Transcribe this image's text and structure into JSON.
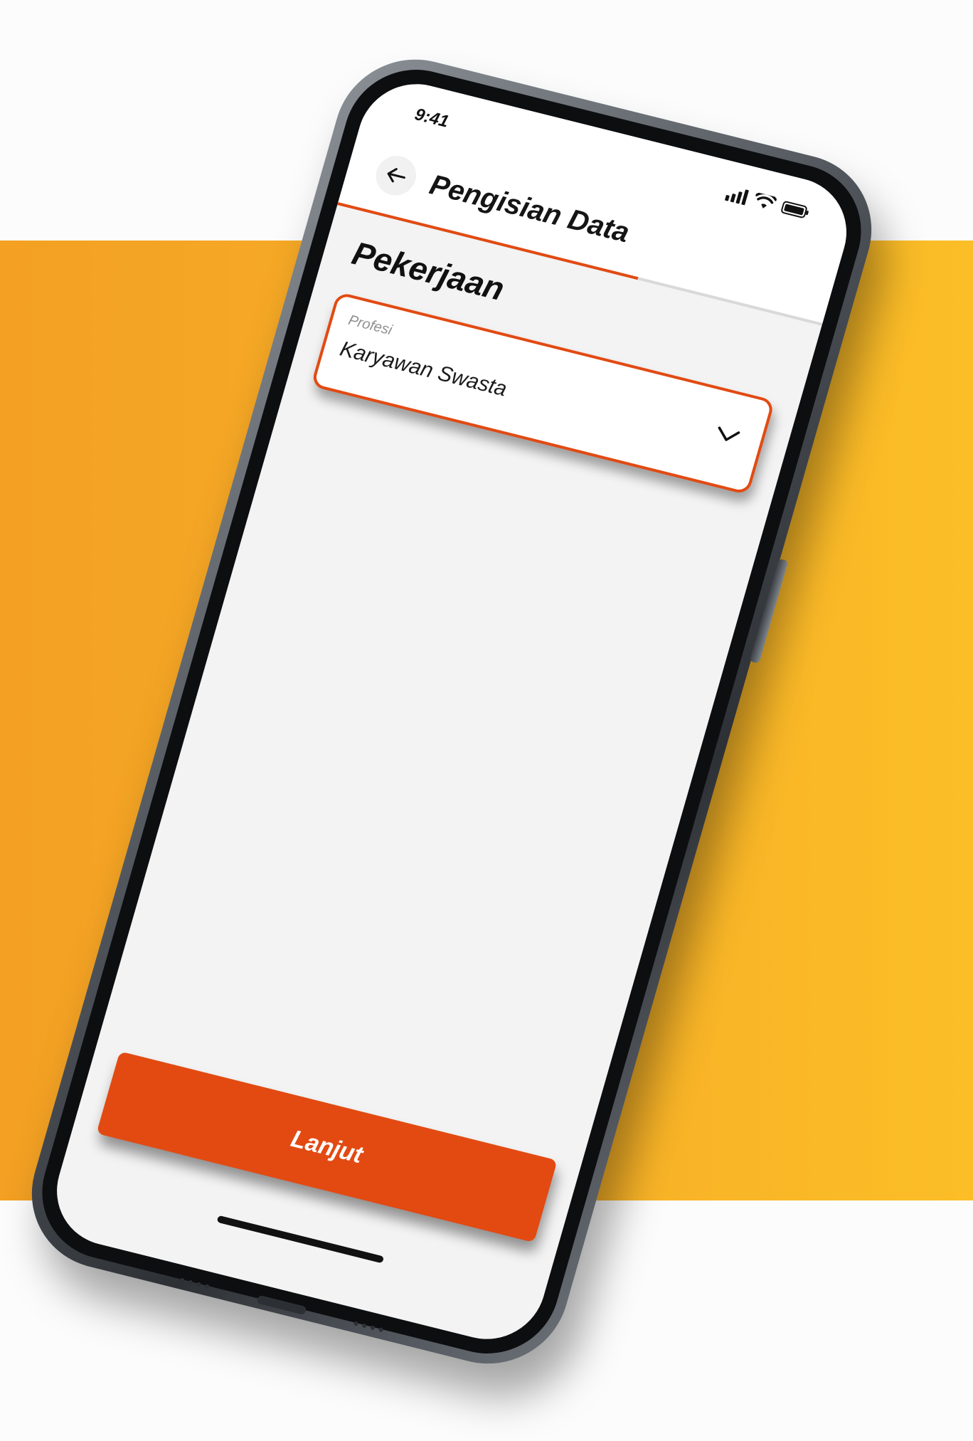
{
  "status_bar": {
    "time": "9:41",
    "icons": [
      "signal-icon",
      "wifi-icon",
      "battery-icon"
    ]
  },
  "header": {
    "back_icon": "arrow-left-icon",
    "title": "Pengisian Data"
  },
  "progress": {
    "fraction": 0.62,
    "fill_color": "#e24a12",
    "track_color": "#d9d9d9"
  },
  "section": {
    "title": "Pekerjaan"
  },
  "profession_field": {
    "label": "Profesi",
    "value": "Karyawan Swasta",
    "icon": "chevron-down-icon",
    "border_color": "#e24a12"
  },
  "footer": {
    "continue_label": "Lanjut",
    "button_color": "#e24a12"
  },
  "colors": {
    "backdrop_left": "#f3a023",
    "backdrop_right": "#fbbe27",
    "screen_background": "#f3f3f3"
  }
}
